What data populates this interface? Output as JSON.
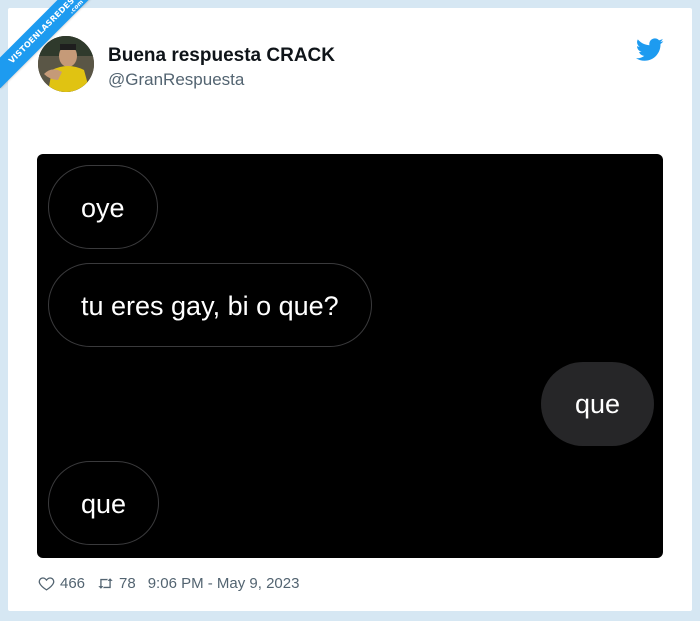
{
  "watermark": {
    "text": "VISTOENLASREDES",
    "sub": ".com",
    "color": "#1d9bf0"
  },
  "tweet": {
    "display_name": "Buena respuesta CRACK",
    "handle": "@GranRespuesta",
    "platform_icon": "twitter-bird-icon",
    "brand_color": "#1d9bf0",
    "likes": "466",
    "retweets": "78",
    "timestamp": "9:06 PM - May 9, 2023"
  },
  "chat": {
    "background": "#000000",
    "messages": [
      {
        "text": "oye",
        "side": "received"
      },
      {
        "text": "tu eres gay, bi o que?",
        "side": "received"
      },
      {
        "text": "que",
        "side": "sent"
      },
      {
        "text": "que",
        "side": "received"
      }
    ]
  },
  "icons": {
    "like": "heart-icon",
    "retweet": "retweet-icon"
  }
}
